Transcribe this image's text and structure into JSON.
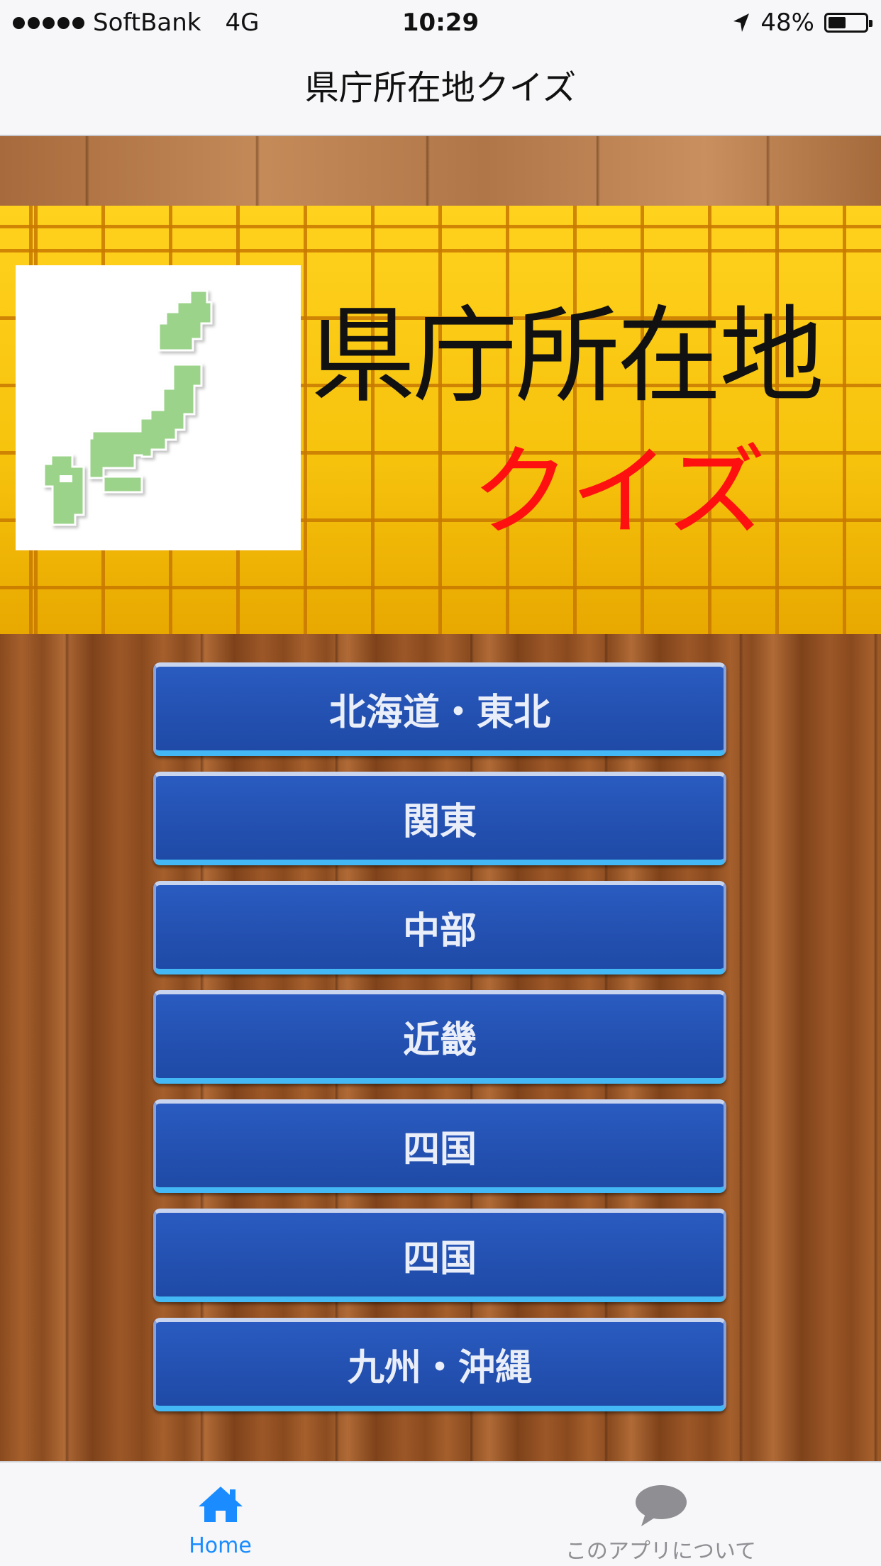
{
  "status_bar": {
    "carrier": "SoftBank",
    "network": "4G",
    "time": "10:29",
    "battery_percent": "48%",
    "battery_level": 0.48,
    "icons": [
      "signal-dots-icon",
      "location-arrow-icon",
      "battery-icon"
    ]
  },
  "nav": {
    "title": "県庁所在地クイズ"
  },
  "banner": {
    "title": "県庁所在地",
    "subtitle": "クイズ",
    "map_icon": "japan-map-icon",
    "colors": {
      "title": "#111111",
      "subtitle": "#ff1010",
      "map": "#9bd38a",
      "grid": "#f6c20c"
    }
  },
  "menu": {
    "items": [
      {
        "label": "北海道・東北"
      },
      {
        "label": "関東"
      },
      {
        "label": "中部"
      },
      {
        "label": "近畿"
      },
      {
        "label": "四国"
      },
      {
        "label": "四国"
      },
      {
        "label": "九州・沖縄"
      }
    ],
    "button_color": "#2452b3"
  },
  "tab_bar": {
    "tabs": [
      {
        "label": "Home",
        "icon": "home-icon",
        "selected": true,
        "color": "#1a8cff"
      },
      {
        "label": "このアプリについて",
        "icon": "speech-bubble-icon",
        "selected": false,
        "color": "#8e8e93"
      }
    ]
  }
}
